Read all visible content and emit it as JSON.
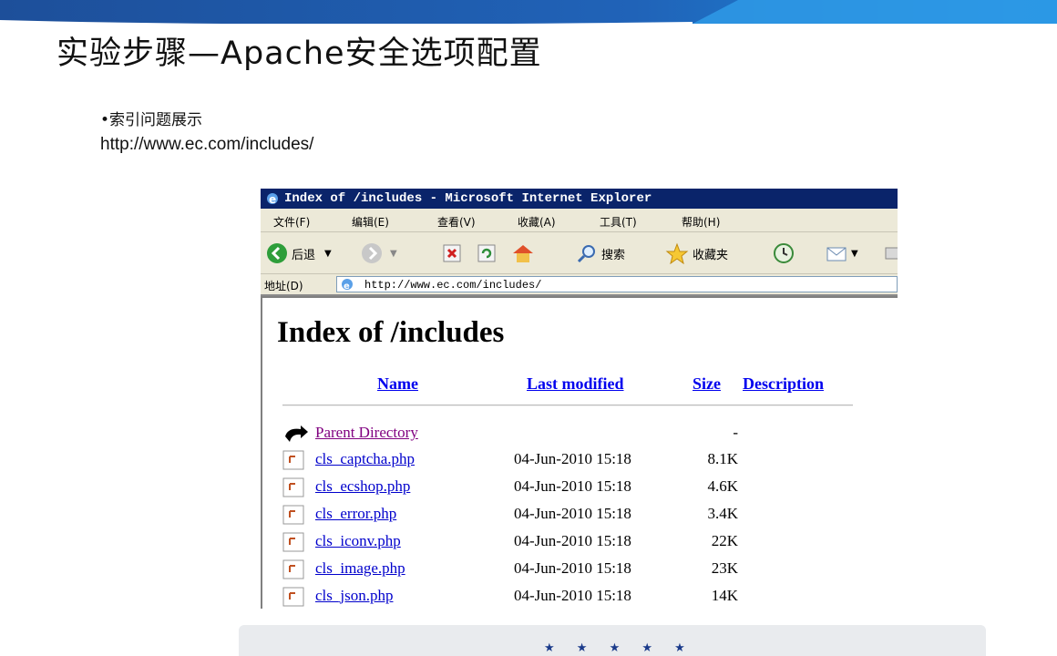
{
  "slide": {
    "title": "实验步骤—Apache安全选项配置",
    "bullet": "•索引问题展示",
    "url": "http://www.ec.com/includes/"
  },
  "browser": {
    "window_title": "Index of /includes - Microsoft Internet Explorer",
    "menu": [
      "文件(F)",
      "编辑(E)",
      "查看(V)",
      "收藏(A)",
      "工具(T)",
      "帮助(H)"
    ],
    "toolbar": {
      "back_label": "后退",
      "search_label": "搜索",
      "favorites_label": "收藏夹"
    },
    "address_label": "地址(D)",
    "address_value": "http://www.ec.com/includes/"
  },
  "page": {
    "heading": "Index of /includes",
    "columns": [
      "Name",
      "Last modified",
      "Size",
      "Description"
    ],
    "rows": [
      {
        "name": "Parent Directory",
        "date": "",
        "size": "-",
        "icon": "parent-dir-icon"
      },
      {
        "name": "cls_captcha.php",
        "date": "04-Jun-2010 15:18",
        "size": "8.1K",
        "icon": "file-icon"
      },
      {
        "name": "cls_ecshop.php",
        "date": "04-Jun-2010 15:18",
        "size": "4.6K",
        "icon": "file-icon"
      },
      {
        "name": "cls_error.php",
        "date": "04-Jun-2010 15:18",
        "size": "3.4K",
        "icon": "file-icon"
      },
      {
        "name": "cls_iconv.php",
        "date": "04-Jun-2010 15:18",
        "size": "22K",
        "icon": "file-icon"
      },
      {
        "name": "cls_image.php",
        "date": "04-Jun-2010 15:18",
        "size": "23K",
        "icon": "file-icon"
      },
      {
        "name": "cls_json.php",
        "date": "04-Jun-2010 15:18",
        "size": "14K",
        "icon": "file-icon"
      }
    ]
  },
  "footer": {
    "stars": "★ ★ ★ ★ ★"
  },
  "colors": {
    "banner": "#1f5aa8",
    "titlebar": "#0A246A",
    "link": "#0000CC",
    "visited": "#800080",
    "chrome": "#ECE9D8"
  }
}
